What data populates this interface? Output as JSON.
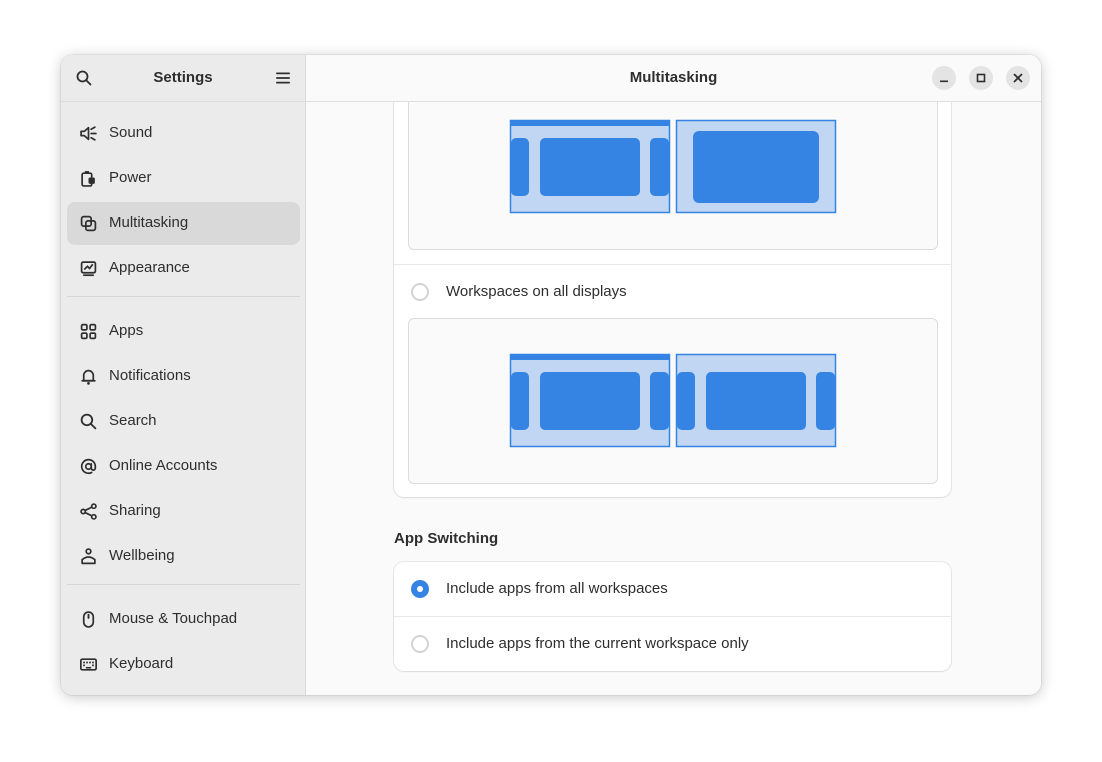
{
  "sidebar": {
    "title": "Settings",
    "items": [
      {
        "label": "Sound",
        "icon": "sound-icon"
      },
      {
        "label": "Power",
        "icon": "power-icon"
      },
      {
        "label": "Multitasking",
        "icon": "multitasking-icon",
        "active": true
      },
      {
        "label": "Appearance",
        "icon": "appearance-icon"
      },
      {
        "label": "Apps",
        "icon": "apps-icon"
      },
      {
        "label": "Notifications",
        "icon": "bell-icon"
      },
      {
        "label": "Search",
        "icon": "search-icon"
      },
      {
        "label": "Online Accounts",
        "icon": "at-icon"
      },
      {
        "label": "Sharing",
        "icon": "share-icon"
      },
      {
        "label": "Wellbeing",
        "icon": "wellbeing-icon"
      },
      {
        "label": "Mouse & Touchpad",
        "icon": "mouse-icon"
      },
      {
        "label": "Keyboard",
        "icon": "keyboard-icon"
      }
    ]
  },
  "main": {
    "title": "Multitasking",
    "workspaces": {
      "option_all_displays": "Workspaces on all displays"
    },
    "app_switching": {
      "heading": "App Switching",
      "options": [
        {
          "label": "Include apps from all workspaces",
          "selected": true
        },
        {
          "label": "Include apps from the current workspace only",
          "selected": false
        }
      ]
    }
  },
  "colors": {
    "accent": "#3584e4",
    "preview_bg": "#c0d6f2"
  }
}
